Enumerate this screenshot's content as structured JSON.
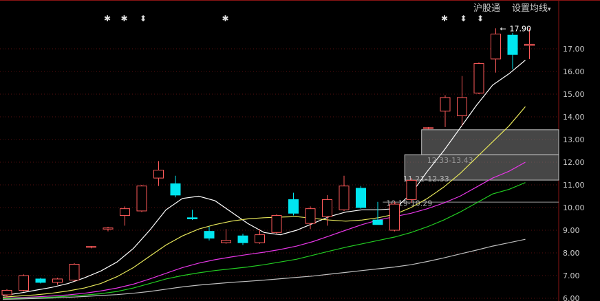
{
  "toolbar": {
    "hgt_label": "沪股通",
    "ma_settings_label": "设置均线"
  },
  "annotations": {
    "high_label": "17.90",
    "zones": [
      {
        "label": "12.33-13.43",
        "low": 12.33,
        "high": 13.43
      },
      {
        "label": "11.21-12.33",
        "low": 11.21,
        "high": 12.33
      },
      {
        "label": "10.19-10.29",
        "low": 10.19,
        "high": 10.29
      }
    ],
    "markers": [
      {
        "candle": 6,
        "icon": "star-icon",
        "glyph": "✱"
      },
      {
        "candle": 7,
        "icon": "star-icon",
        "glyph": "✱"
      },
      {
        "candle": 8,
        "icon": "double-arrow-icon",
        "glyph": "⬍"
      },
      {
        "candle": 13,
        "icon": "star-icon",
        "glyph": "✱"
      },
      {
        "candle": 26,
        "icon": "star-icon",
        "glyph": "✱"
      },
      {
        "candle": 27,
        "icon": "double-arrow-icon",
        "glyph": "⬍"
      },
      {
        "candle": 28,
        "icon": "double-arrow-icon",
        "glyph": "⬍"
      }
    ]
  },
  "colors": {
    "up": "#ff5a5a",
    "down": "#00e6f0",
    "ma1": "#ffffff",
    "ma2": "#e6e65a",
    "ma3": "#e636e6",
    "ma4": "#22cc22",
    "ma5": "#bfbfbf",
    "grid": "#5a1010",
    "axis_text": "#c8c8c8",
    "zone_fill": "#808080",
    "support_line": "#9a9a9a"
  },
  "chart_data": {
    "type": "candlestick",
    "ylim": [
      6.0,
      18.0
    ],
    "y_ticks": [
      "6.00",
      "7.00",
      "8.00",
      "9.00",
      "10.00",
      "11.00",
      "12.00",
      "13.00",
      "14.00",
      "15.00",
      "16.00",
      "17.00"
    ],
    "candles": [
      {
        "open": 6.15,
        "high": 6.4,
        "low": 6.05,
        "close": 6.35
      },
      {
        "open": 6.35,
        "high": 7.05,
        "low": 6.3,
        "close": 7.0
      },
      {
        "open": 6.85,
        "high": 6.9,
        "low": 6.65,
        "close": 6.7
      },
      {
        "open": 6.7,
        "high": 6.9,
        "low": 6.6,
        "close": 6.85
      },
      {
        "open": 6.8,
        "high": 7.55,
        "low": 6.75,
        "close": 7.5
      },
      {
        "open": 8.25,
        "high": 8.3,
        "low": 8.2,
        "close": 8.28
      },
      {
        "open": 9.05,
        "high": 9.15,
        "low": 8.95,
        "close": 9.1
      },
      {
        "open": 9.65,
        "high": 10.05,
        "low": 9.2,
        "close": 9.95
      },
      {
        "open": 9.85,
        "high": 11.0,
        "low": 9.8,
        "close": 10.95
      },
      {
        "open": 11.3,
        "high": 12.05,
        "low": 10.95,
        "close": 11.65
      },
      {
        "open": 11.05,
        "high": 11.4,
        "low": 10.45,
        "close": 10.55
      },
      {
        "open": 9.55,
        "high": 9.9,
        "low": 9.45,
        "close": 9.5
      },
      {
        "open": 8.95,
        "high": 9.15,
        "low": 8.55,
        "close": 8.65
      },
      {
        "open": 8.45,
        "high": 9.05,
        "low": 8.4,
        "close": 8.55
      },
      {
        "open": 8.75,
        "high": 8.85,
        "low": 8.35,
        "close": 8.45
      },
      {
        "open": 8.45,
        "high": 9.05,
        "low": 8.4,
        "close": 8.8
      },
      {
        "open": 8.9,
        "high": 9.7,
        "low": 8.85,
        "close": 9.65
      },
      {
        "open": 10.35,
        "high": 10.65,
        "low": 9.65,
        "close": 9.75
      },
      {
        "open": 9.3,
        "high": 10.05,
        "low": 9.05,
        "close": 9.95
      },
      {
        "open": 9.6,
        "high": 10.55,
        "low": 9.2,
        "close": 10.35
      },
      {
        "open": 9.9,
        "high": 11.4,
        "low": 9.85,
        "close": 10.95
      },
      {
        "open": 10.85,
        "high": 10.95,
        "low": 9.95,
        "close": 10.0
      },
      {
        "open": 9.45,
        "high": 10.25,
        "low": 9.25,
        "close": 9.25
      },
      {
        "open": 9.0,
        "high": 10.25,
        "low": 8.95,
        "close": 10.15
      },
      {
        "open": 10.35,
        "high": 11.3,
        "low": 10.2,
        "close": 11.2
      },
      {
        "open": 13.5,
        "high": 13.55,
        "low": 13.45,
        "close": 13.52
      },
      {
        "open": 14.25,
        "high": 14.95,
        "low": 13.55,
        "close": 14.85
      },
      {
        "open": 14.05,
        "high": 15.8,
        "low": 13.6,
        "close": 14.85
      },
      {
        "open": 15.05,
        "high": 16.4,
        "low": 15.0,
        "close": 16.35
      },
      {
        "open": 16.55,
        "high": 17.9,
        "low": 15.95,
        "close": 17.65
      },
      {
        "open": 17.6,
        "high": 17.7,
        "low": 16.1,
        "close": 16.75
      },
      {
        "open": 17.15,
        "high": 17.9,
        "low": 16.55,
        "close": 17.2
      }
    ],
    "series": [
      {
        "values": [
          6.12,
          6.22,
          6.35,
          6.48,
          6.65,
          6.9,
          7.2,
          7.6,
          8.2,
          9.0,
          9.9,
          10.4,
          10.5,
          10.3,
          9.8,
          9.3,
          8.9,
          8.8,
          9.0,
          9.3,
          9.6,
          9.8,
          9.9,
          9.9,
          9.95,
          10.6,
          11.6,
          12.5,
          13.5,
          14.5,
          15.4,
          15.9,
          16.5
        ]
      },
      {
        "values": [
          6.05,
          6.1,
          6.15,
          6.22,
          6.32,
          6.45,
          6.65,
          6.95,
          7.35,
          7.85,
          8.35,
          8.75,
          9.05,
          9.25,
          9.4,
          9.5,
          9.55,
          9.58,
          9.6,
          9.52,
          9.45,
          9.4,
          9.45,
          9.55,
          9.7,
          10.0,
          10.4,
          10.9,
          11.5,
          12.2,
          12.9,
          13.6,
          14.45
        ]
      },
      {
        "values": [
          6.0,
          6.03,
          6.06,
          6.1,
          6.15,
          6.22,
          6.32,
          6.45,
          6.62,
          6.85,
          7.1,
          7.35,
          7.55,
          7.7,
          7.82,
          7.93,
          8.03,
          8.15,
          8.3,
          8.5,
          8.75,
          9.0,
          9.25,
          9.45,
          9.6,
          9.75,
          9.95,
          10.2,
          10.5,
          10.9,
          11.3,
          11.6,
          12.0
        ]
      },
      {
        "values": [
          5.98,
          6.0,
          6.02,
          6.05,
          6.09,
          6.14,
          6.2,
          6.3,
          6.45,
          6.65,
          6.85,
          7.0,
          7.12,
          7.22,
          7.3,
          7.38,
          7.48,
          7.6,
          7.72,
          7.9,
          8.08,
          8.25,
          8.4,
          8.55,
          8.7,
          8.9,
          9.15,
          9.45,
          9.8,
          10.2,
          10.6,
          10.8,
          11.1
        ]
      },
      {
        "values": [
          5.95,
          5.97,
          5.99,
          6.01,
          6.04,
          6.08,
          6.12,
          6.16,
          6.22,
          6.3,
          6.4,
          6.5,
          6.58,
          6.64,
          6.7,
          6.75,
          6.8,
          6.86,
          6.92,
          6.98,
          7.06,
          7.14,
          7.22,
          7.3,
          7.38,
          7.48,
          7.62,
          7.78,
          7.95,
          8.12,
          8.3,
          8.45,
          8.6
        ]
      }
    ],
    "support_level": 10.24,
    "y_reference_tick_label": "10.00"
  }
}
